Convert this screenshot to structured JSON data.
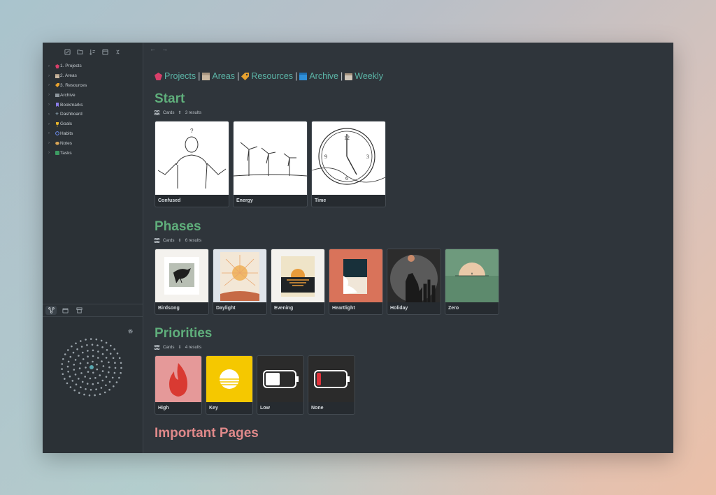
{
  "sidebar": {
    "tree": [
      {
        "label": "1. Projects",
        "icon": "projects-gem-icon"
      },
      {
        "label": "2. Areas",
        "icon": "areas-box-icon"
      },
      {
        "label": "3. Resources",
        "icon": "resources-tag-icon"
      },
      {
        "label": "Archive",
        "icon": "archive-box-icon"
      },
      {
        "label": "Bookmarks",
        "icon": "bookmark-icon"
      },
      {
        "label": "Dashboard",
        "icon": "dashboard-icon"
      },
      {
        "label": "Goals",
        "icon": "trophy-icon"
      },
      {
        "label": "Habits",
        "icon": "habits-circle-icon"
      },
      {
        "label": "Notes",
        "icon": "notes-icon"
      },
      {
        "label": "Tasks",
        "icon": "tasks-icon"
      }
    ]
  },
  "nav": {
    "links": [
      {
        "label": "Projects",
        "icon": "projects-gem-icon",
        "color": "#d93f6a"
      },
      {
        "label": "Areas",
        "icon": "areas-box-icon",
        "color": "#c9b7a0"
      },
      {
        "label": "Resources",
        "icon": "resources-tag-icon",
        "color": "#e8a22f"
      },
      {
        "label": "Archive",
        "icon": "archive-box-icon",
        "color": "#2f8fd8"
      },
      {
        "label": "Weekly",
        "icon": "calendar-icon",
        "color": "#cfc5b8"
      }
    ],
    "separator": "|"
  },
  "sections": {
    "start": {
      "title": "Start",
      "view": "Cards",
      "count": "3 results",
      "cards": [
        {
          "label": "Confused"
        },
        {
          "label": "Energy"
        },
        {
          "label": "Time"
        }
      ]
    },
    "phases": {
      "title": "Phases",
      "view": "Cards",
      "count": "6 results",
      "cards": [
        {
          "label": "Birdsong"
        },
        {
          "label": "Daylight"
        },
        {
          "label": "Evening"
        },
        {
          "label": "Heartlight"
        },
        {
          "label": "Holiday"
        },
        {
          "label": "Zero"
        }
      ]
    },
    "priorities": {
      "title": "Priorities",
      "view": "Cards",
      "count": "4 results",
      "cards": [
        {
          "label": "High"
        },
        {
          "label": "Key"
        },
        {
          "label": "Low"
        },
        {
          "label": "None"
        }
      ]
    },
    "important": {
      "title": "Important Pages"
    }
  },
  "colors": {
    "accent_green": "#5fae7b",
    "accent_pink": "#e0898a",
    "link_teal": "#5bb4a6"
  }
}
